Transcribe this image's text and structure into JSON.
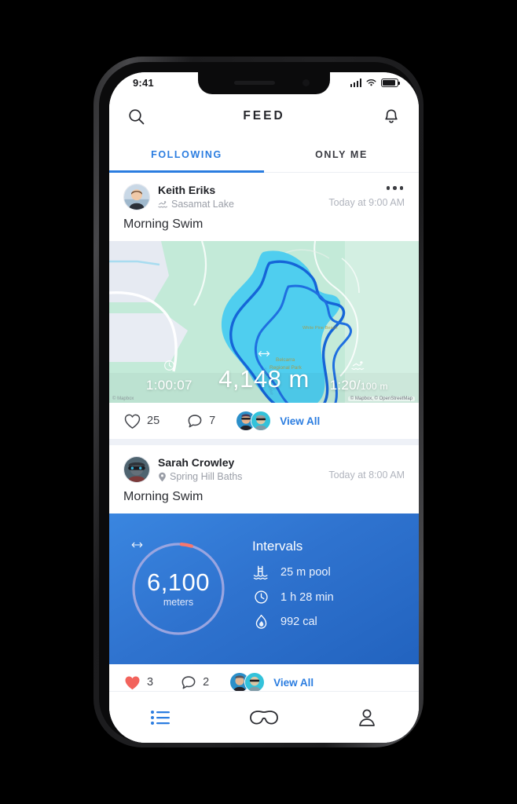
{
  "status_bar": {
    "time": "9:41",
    "signal_icon": "cellular-bars-icon",
    "wifi_icon": "wifi-icon",
    "battery_icon": "battery-icon"
  },
  "header": {
    "title": "FEED",
    "search_icon": "search-icon",
    "bell_icon": "bell-icon"
  },
  "tabs": [
    {
      "label": "FOLLOWING",
      "active": true
    },
    {
      "label": "ONLY ME",
      "active": false
    }
  ],
  "colors": {
    "accent": "#2b7de0",
    "card_blue": "#2f73cf",
    "ring": "#9aa5e0",
    "ring_progress": "#f7776f",
    "like_red": "#f2635c",
    "muted_text": "#9a9ea7"
  },
  "posts": [
    {
      "user": "Keith Eriks",
      "location": "Sasamat Lake",
      "location_icon": "swimmer-icon",
      "time": "Today at 9:00 AM",
      "title": "Morning Swim",
      "more_icon": "more-options-icon",
      "map": {
        "attribution": "© Mapbox, © OpenStreetMap",
        "attribution_left": "© Mapbox",
        "labels": [
          "Belcarra",
          "Regional Park",
          "Sasamat Lake",
          "White Pine Beach"
        ],
        "stats": [
          {
            "icon": "clock-icon",
            "value": "1:00:07",
            "unit": ""
          },
          {
            "icon": "distance-arrow-icon",
            "value": "4,148 m",
            "unit": ""
          },
          {
            "icon": "swimmer-icon",
            "value": "1:20/",
            "unit": "100 m"
          }
        ]
      },
      "actions": {
        "like_icon": "heart-outline-icon",
        "likes": "25",
        "comment_icon": "comment-bubble-icon",
        "comments": "7",
        "view_all": "View All"
      }
    },
    {
      "user": "Sarah Crowley",
      "location": "Spring Hill Baths",
      "location_icon": "map-pin-icon",
      "time": "Today at 8:00 AM",
      "title": "Morning Swim",
      "summary": {
        "ring_value": "6,100",
        "ring_unit": "meters",
        "ring_icon": "distance-arrow-icon",
        "heading": "Intervals",
        "rows": [
          {
            "icon": "pool-ladder-icon",
            "text": "25 m pool"
          },
          {
            "icon": "clock-icon",
            "text": "1 h 28 min"
          },
          {
            "icon": "flame-icon",
            "text": "992 cal"
          }
        ]
      },
      "actions": {
        "like_icon": "heart-filled-icon",
        "likes": "3",
        "comment_icon": "comment-bubble-icon",
        "comments": "2",
        "view_all": "View All"
      }
    }
  ],
  "bottom_nav": [
    {
      "icon": "list-feed-icon",
      "active": true
    },
    {
      "icon": "goggles-icon",
      "active": false
    },
    {
      "icon": "profile-person-icon",
      "active": false
    }
  ]
}
